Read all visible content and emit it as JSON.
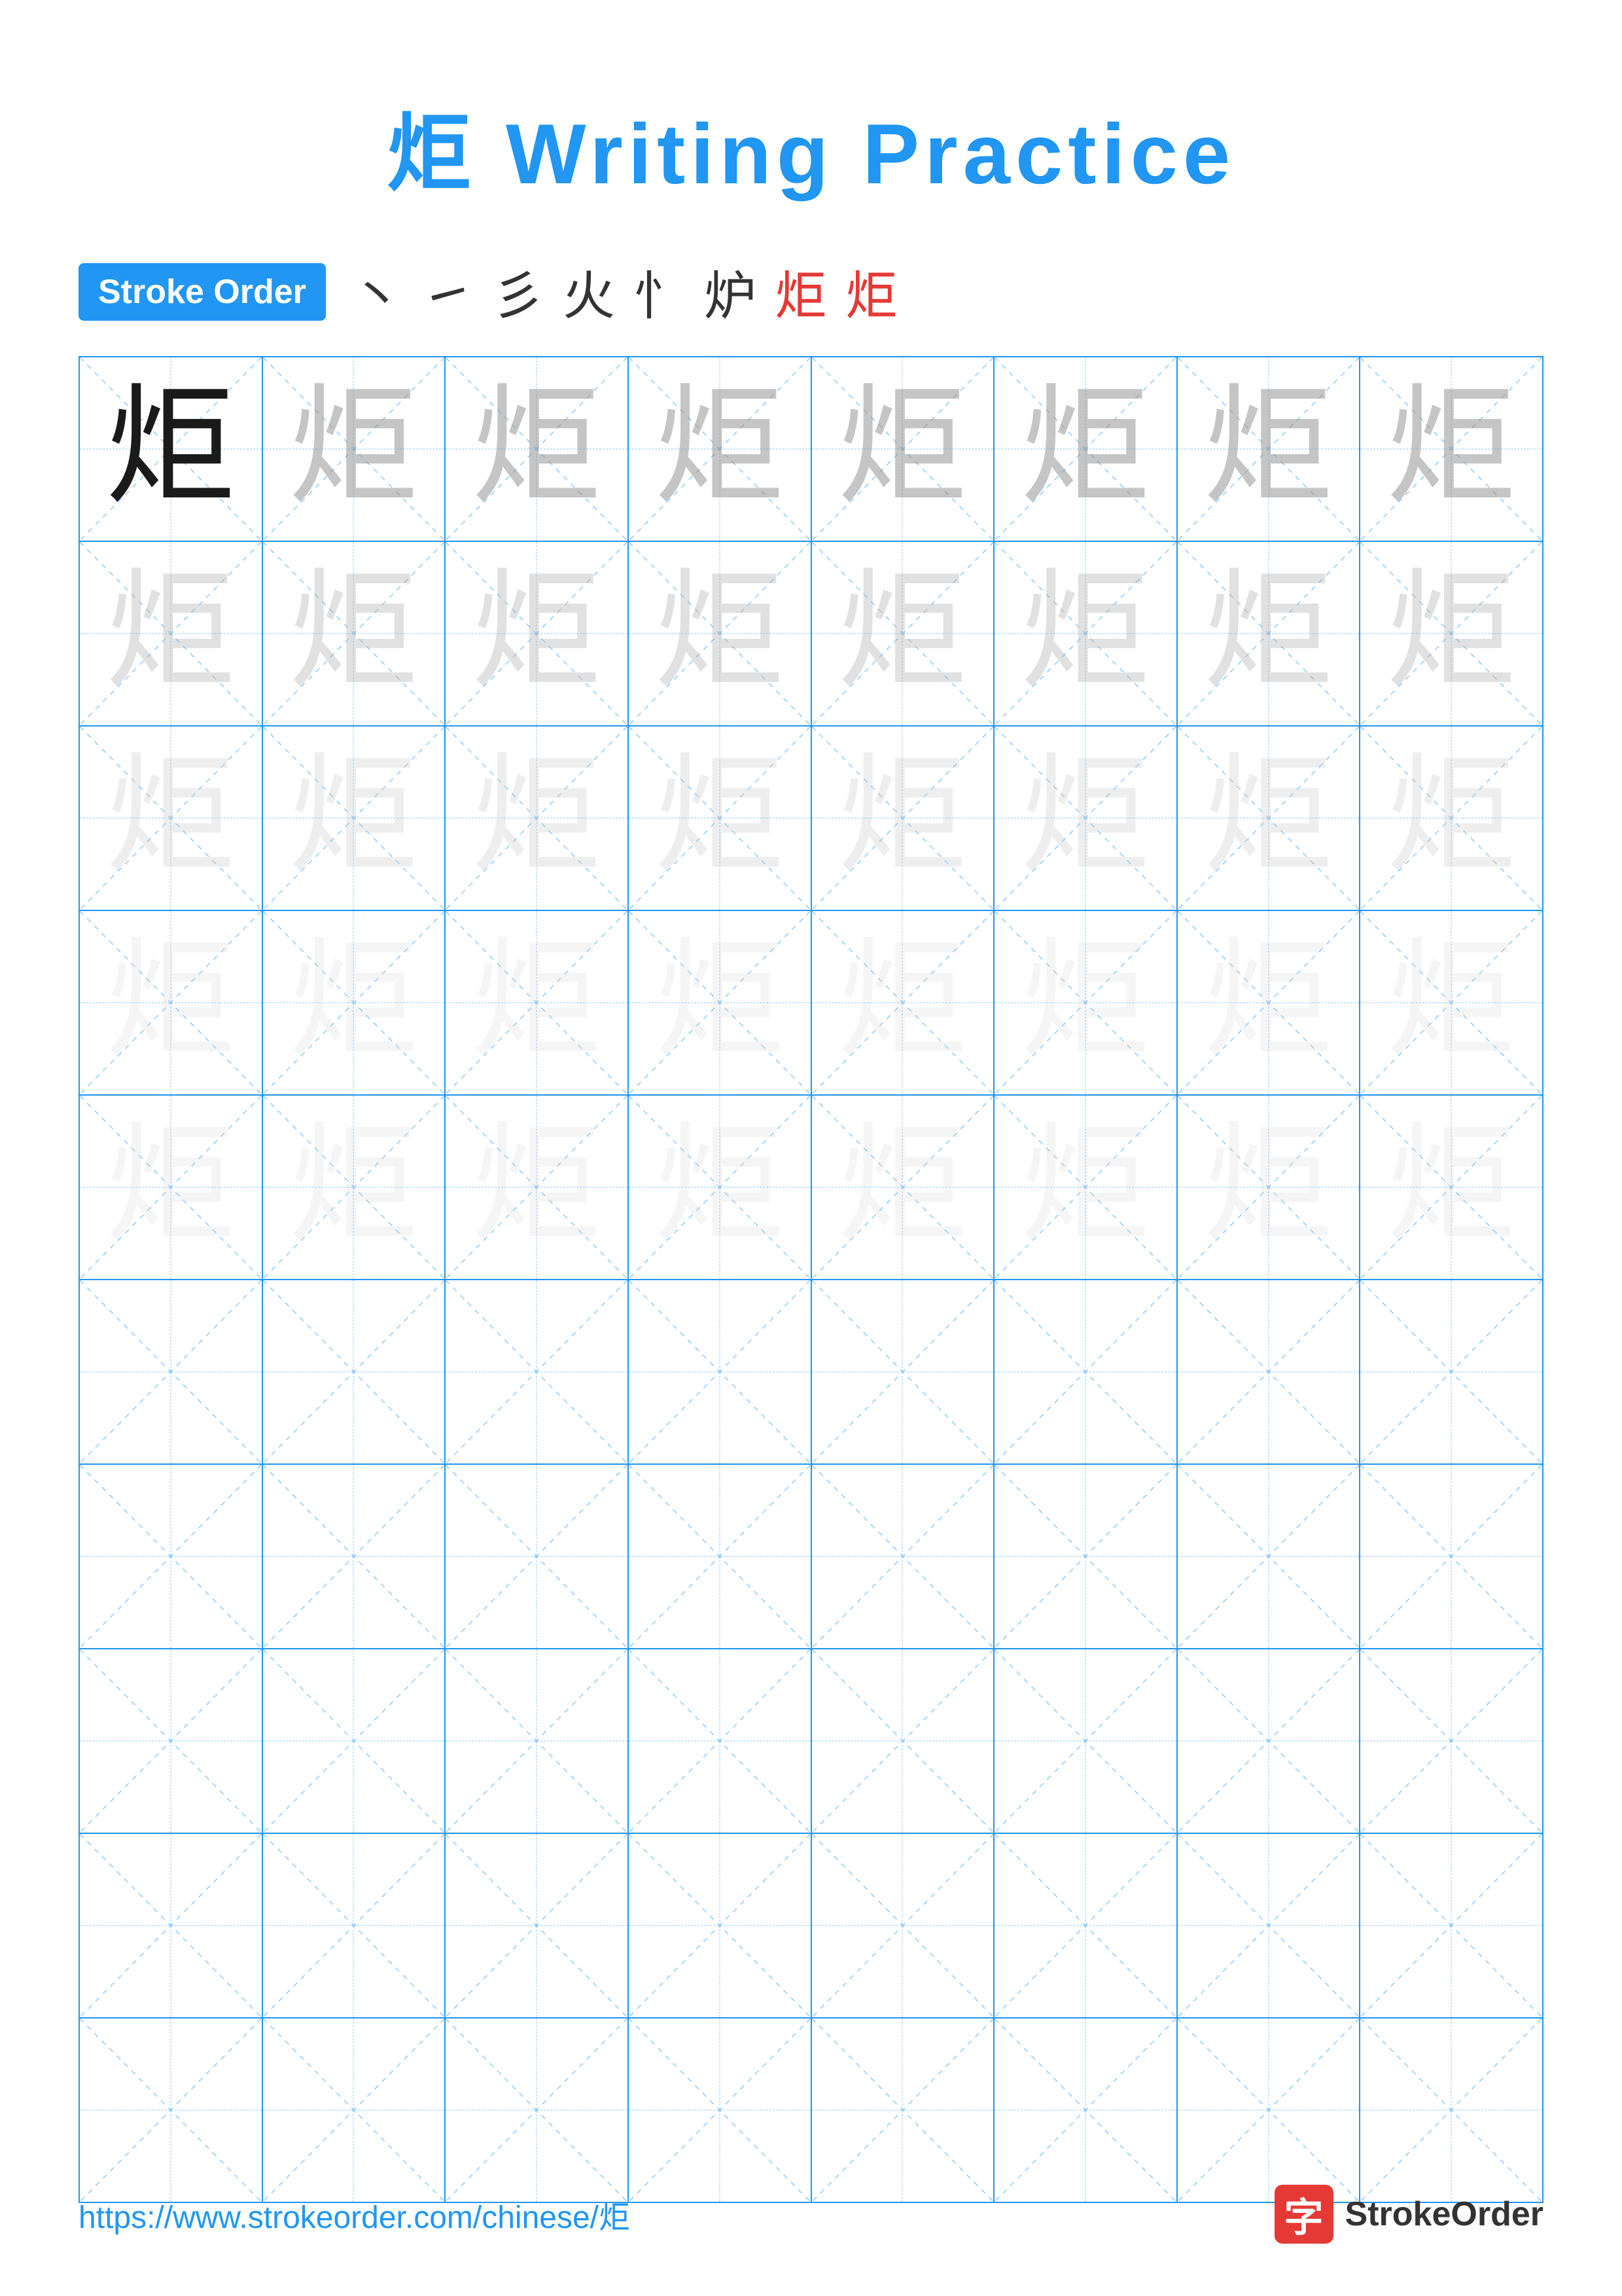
{
  "title": "炬 Writing Practice",
  "stroke_order": {
    "badge_label": "Stroke Order",
    "strokes": [
      "丶",
      "㇀",
      "彡",
      "火",
      "忄",
      "炉",
      "炬",
      "炬"
    ]
  },
  "character": "炬",
  "grid": {
    "rows": 10,
    "cols": 8
  },
  "footer": {
    "url": "https://www.strokeorder.com/chinese/炬",
    "brand_char": "字",
    "brand_name": "StrokeOrder"
  }
}
